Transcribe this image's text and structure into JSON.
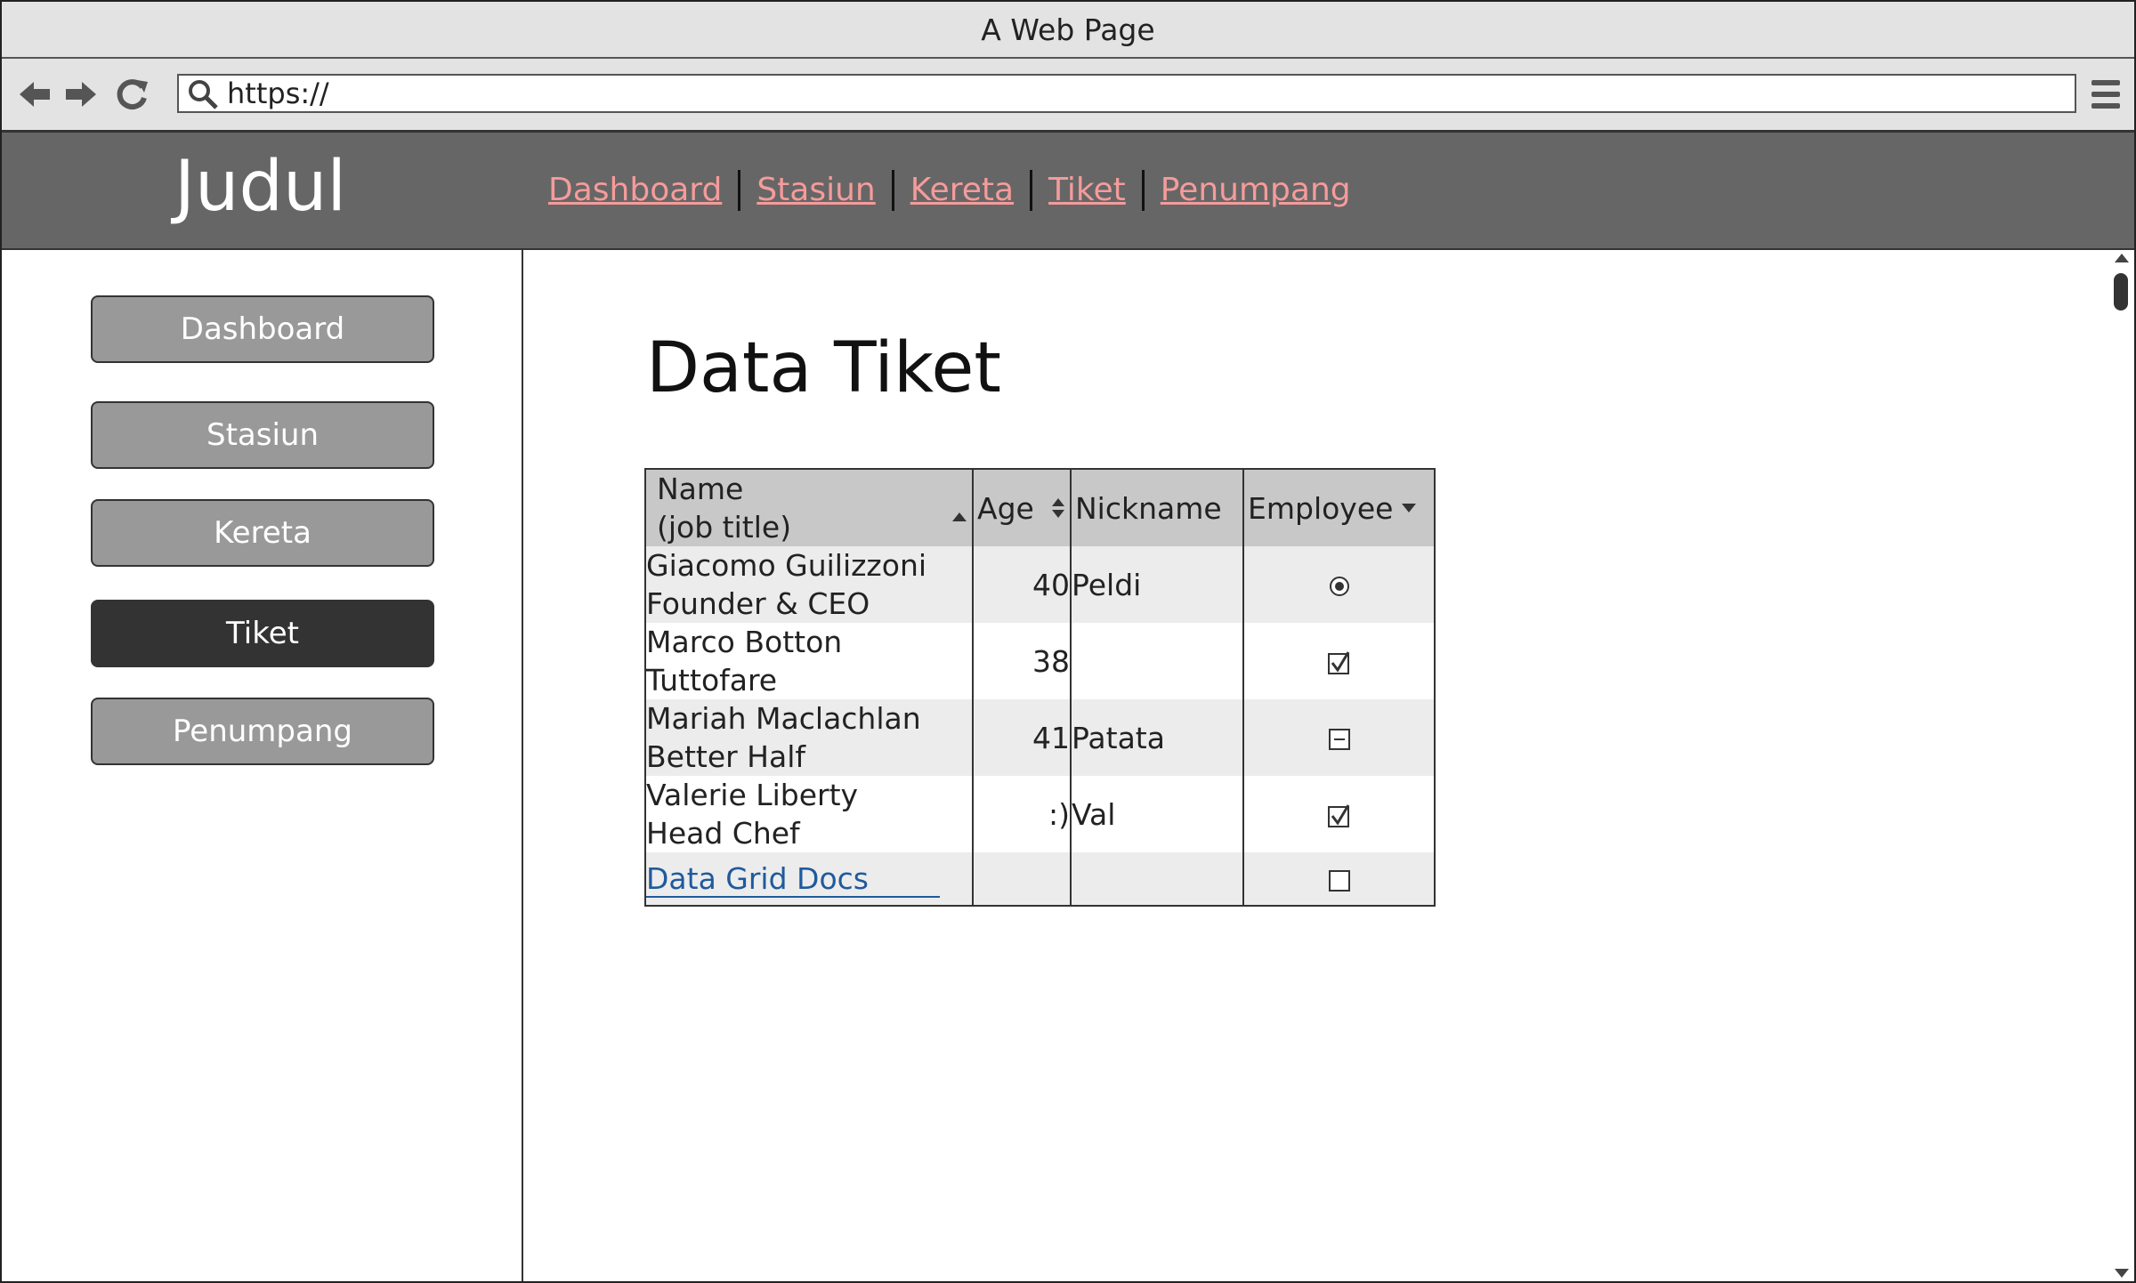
{
  "window": {
    "title": "A Web Page"
  },
  "browser": {
    "url": "https://"
  },
  "header": {
    "brand": "Judul",
    "nav": [
      "Dashboard",
      "Stasiun",
      "Kereta",
      "Tiket",
      "Penumpang"
    ],
    "link_color": "#f59b9b"
  },
  "sidebar": {
    "items": [
      {
        "label": "Dashboard",
        "active": false
      },
      {
        "label": "Stasiun",
        "active": false
      },
      {
        "label": "Kereta",
        "active": false
      },
      {
        "label": "Tiket",
        "active": true
      },
      {
        "label": "Penumpang",
        "active": false
      }
    ]
  },
  "main": {
    "title": "Data Tiket"
  },
  "grid": {
    "headers": {
      "name_line1": "Name",
      "name_line2": "(job title)",
      "age": "Age",
      "nickname": "Nickname",
      "employee": "Employee"
    },
    "rows": [
      {
        "name": "Giacomo Guilizzoni",
        "title": "Founder & CEO",
        "age": "40",
        "nickname": "Peldi",
        "employee": "radio-selected"
      },
      {
        "name": "Marco Botton",
        "title": "Tuttofare",
        "age": "38",
        "nickname": "",
        "employee": "checked"
      },
      {
        "name": "Mariah Maclachlan",
        "title": "Better Half",
        "age": "41",
        "nickname": "Patata",
        "employee": "indeterminate"
      },
      {
        "name": "Valerie Liberty",
        "title": "Head Chef",
        "age": ":)",
        "nickname": "Val",
        "employee": "checked"
      }
    ],
    "footer_link": "Data Grid Docs",
    "footer_employee": "unchecked",
    "link_color": "#1f5a9c"
  }
}
